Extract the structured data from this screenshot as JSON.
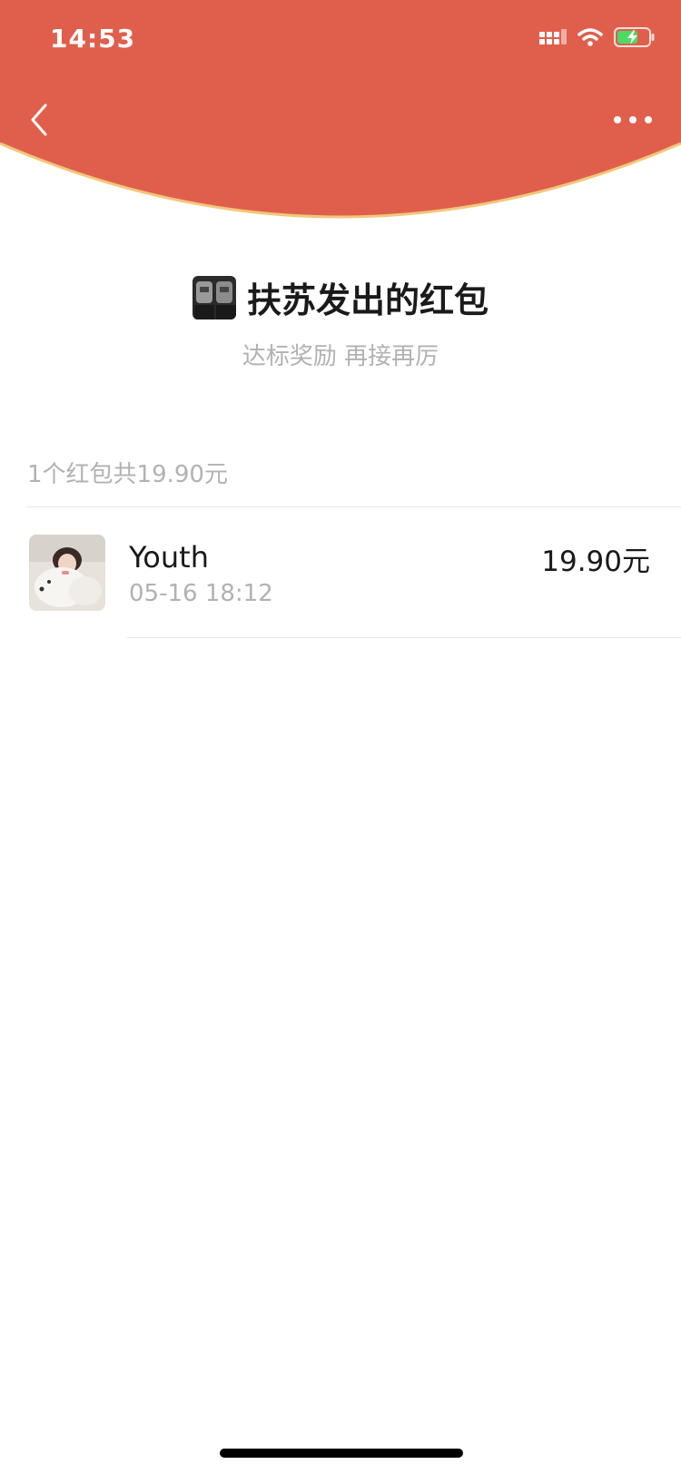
{
  "colors": {
    "header_red": "#E05F4C",
    "header_edge": "#F2C77A",
    "primary_text": "#1a1a1a",
    "secondary_text": "#b2b2b2",
    "divider": "#e5e5e5"
  },
  "status_bar": {
    "time": "14:53",
    "icons": [
      "signal-icon",
      "wifi-icon",
      "battery-charging-icon"
    ]
  },
  "nav": {
    "back_icon": "chevron-left-icon",
    "more_icon": "more-dots-icon"
  },
  "packet": {
    "sender_title": "扶苏发出的红包",
    "wish": "达标奖励 再接再厉",
    "summary": "1个红包共19.90元"
  },
  "receivers": [
    {
      "name": "Youth",
      "time": "05-16 18:12",
      "amount": "19.90元"
    }
  ]
}
